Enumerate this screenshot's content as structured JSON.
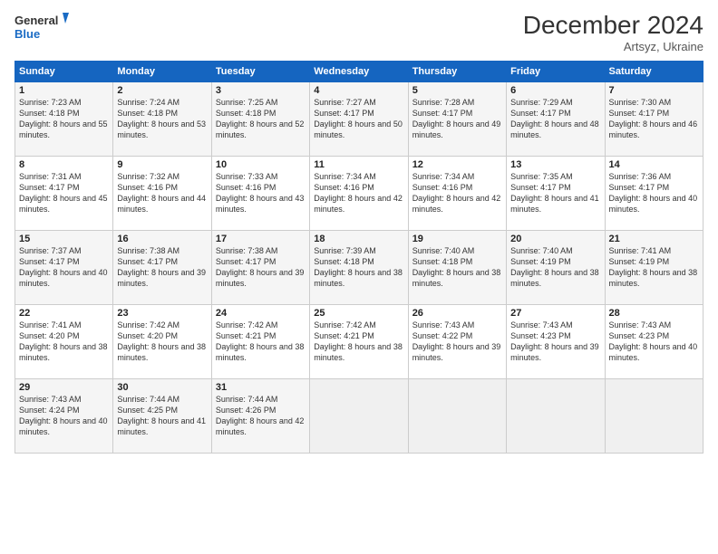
{
  "header": {
    "logo_general": "General",
    "logo_blue": "Blue",
    "month_title": "December 2024",
    "subtitle": "Artsyz, Ukraine"
  },
  "days_of_week": [
    "Sunday",
    "Monday",
    "Tuesday",
    "Wednesday",
    "Thursday",
    "Friday",
    "Saturday"
  ],
  "weeks": [
    [
      {
        "day": "1",
        "sunrise": "7:23 AM",
        "sunset": "4:18 PM",
        "daylight": "8 hours and 55 minutes."
      },
      {
        "day": "2",
        "sunrise": "7:24 AM",
        "sunset": "4:18 PM",
        "daylight": "8 hours and 53 minutes."
      },
      {
        "day": "3",
        "sunrise": "7:25 AM",
        "sunset": "4:18 PM",
        "daylight": "8 hours and 52 minutes."
      },
      {
        "day": "4",
        "sunrise": "7:27 AM",
        "sunset": "4:17 PM",
        "daylight": "8 hours and 50 minutes."
      },
      {
        "day": "5",
        "sunrise": "7:28 AM",
        "sunset": "4:17 PM",
        "daylight": "8 hours and 49 minutes."
      },
      {
        "day": "6",
        "sunrise": "7:29 AM",
        "sunset": "4:17 PM",
        "daylight": "8 hours and 48 minutes."
      },
      {
        "day": "7",
        "sunrise": "7:30 AM",
        "sunset": "4:17 PM",
        "daylight": "8 hours and 46 minutes."
      }
    ],
    [
      {
        "day": "8",
        "sunrise": "7:31 AM",
        "sunset": "4:17 PM",
        "daylight": "8 hours and 45 minutes."
      },
      {
        "day": "9",
        "sunrise": "7:32 AM",
        "sunset": "4:16 PM",
        "daylight": "8 hours and 44 minutes."
      },
      {
        "day": "10",
        "sunrise": "7:33 AM",
        "sunset": "4:16 PM",
        "daylight": "8 hours and 43 minutes."
      },
      {
        "day": "11",
        "sunrise": "7:34 AM",
        "sunset": "4:16 PM",
        "daylight": "8 hours and 42 minutes."
      },
      {
        "day": "12",
        "sunrise": "7:34 AM",
        "sunset": "4:16 PM",
        "daylight": "8 hours and 42 minutes."
      },
      {
        "day": "13",
        "sunrise": "7:35 AM",
        "sunset": "4:17 PM",
        "daylight": "8 hours and 41 minutes."
      },
      {
        "day": "14",
        "sunrise": "7:36 AM",
        "sunset": "4:17 PM",
        "daylight": "8 hours and 40 minutes."
      }
    ],
    [
      {
        "day": "15",
        "sunrise": "7:37 AM",
        "sunset": "4:17 PM",
        "daylight": "8 hours and 40 minutes."
      },
      {
        "day": "16",
        "sunrise": "7:38 AM",
        "sunset": "4:17 PM",
        "daylight": "8 hours and 39 minutes."
      },
      {
        "day": "17",
        "sunrise": "7:38 AM",
        "sunset": "4:17 PM",
        "daylight": "8 hours and 39 minutes."
      },
      {
        "day": "18",
        "sunrise": "7:39 AM",
        "sunset": "4:18 PM",
        "daylight": "8 hours and 38 minutes."
      },
      {
        "day": "19",
        "sunrise": "7:40 AM",
        "sunset": "4:18 PM",
        "daylight": "8 hours and 38 minutes."
      },
      {
        "day": "20",
        "sunrise": "7:40 AM",
        "sunset": "4:19 PM",
        "daylight": "8 hours and 38 minutes."
      },
      {
        "day": "21",
        "sunrise": "7:41 AM",
        "sunset": "4:19 PM",
        "daylight": "8 hours and 38 minutes."
      }
    ],
    [
      {
        "day": "22",
        "sunrise": "7:41 AM",
        "sunset": "4:20 PM",
        "daylight": "8 hours and 38 minutes."
      },
      {
        "day": "23",
        "sunrise": "7:42 AM",
        "sunset": "4:20 PM",
        "daylight": "8 hours and 38 minutes."
      },
      {
        "day": "24",
        "sunrise": "7:42 AM",
        "sunset": "4:21 PM",
        "daylight": "8 hours and 38 minutes."
      },
      {
        "day": "25",
        "sunrise": "7:42 AM",
        "sunset": "4:21 PM",
        "daylight": "8 hours and 38 minutes."
      },
      {
        "day": "26",
        "sunrise": "7:43 AM",
        "sunset": "4:22 PM",
        "daylight": "8 hours and 39 minutes."
      },
      {
        "day": "27",
        "sunrise": "7:43 AM",
        "sunset": "4:23 PM",
        "daylight": "8 hours and 39 minutes."
      },
      {
        "day": "28",
        "sunrise": "7:43 AM",
        "sunset": "4:23 PM",
        "daylight": "8 hours and 40 minutes."
      }
    ],
    [
      {
        "day": "29",
        "sunrise": "7:43 AM",
        "sunset": "4:24 PM",
        "daylight": "8 hours and 40 minutes."
      },
      {
        "day": "30",
        "sunrise": "7:44 AM",
        "sunset": "4:25 PM",
        "daylight": "8 hours and 41 minutes."
      },
      {
        "day": "31",
        "sunrise": "7:44 AM",
        "sunset": "4:26 PM",
        "daylight": "8 hours and 42 minutes."
      },
      null,
      null,
      null,
      null
    ]
  ],
  "labels": {
    "sunrise": "Sunrise:",
    "sunset": "Sunset:",
    "daylight": "Daylight:"
  }
}
